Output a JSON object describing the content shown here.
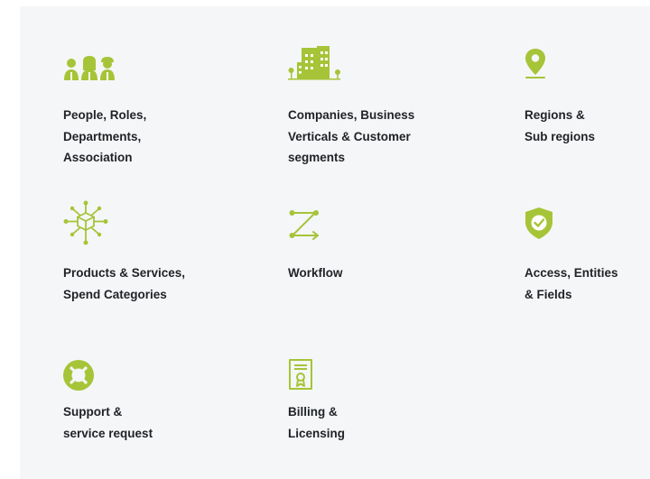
{
  "accent_color": "#a6c437",
  "features": [
    {
      "icon": "people-group-icon",
      "label": "People, Roles,\nDepartments,\nAssociation"
    },
    {
      "icon": "buildings-icon",
      "label": "Companies, Business\nVerticals & Customer\nsegments"
    },
    {
      "icon": "location-pin-icon",
      "label": "Regions &\nSub regions"
    },
    {
      "icon": "product-network-icon",
      "label": "Products & Services,\nSpend Categories"
    },
    {
      "icon": "workflow-icon",
      "label": "Workflow"
    },
    {
      "icon": "shield-check-icon",
      "label": "Access, Entities\n& Fields"
    },
    {
      "icon": "lifebuoy-icon",
      "label": "Support &\nservice request"
    },
    {
      "icon": "certificate-icon",
      "label": "Billing &\nLicensing"
    }
  ]
}
